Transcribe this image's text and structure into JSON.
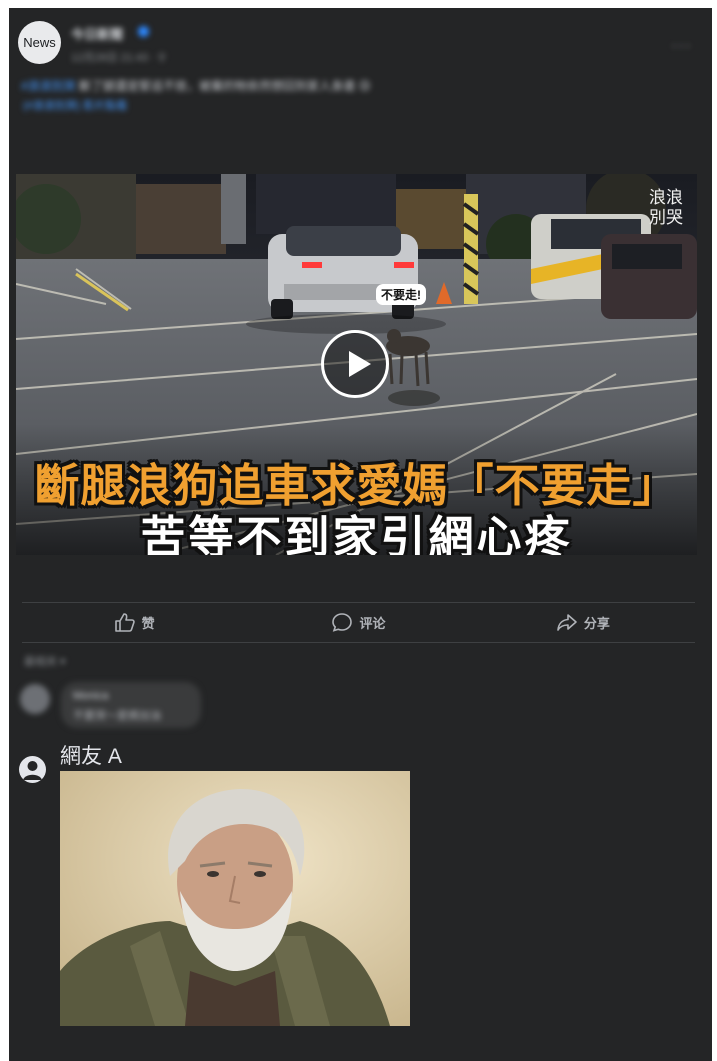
{
  "post": {
    "avatar_label": "News",
    "page_name": "今日新聞",
    "time": "12月28日 21:43 · ⚲",
    "more": "···",
    "caption_tag": "#浪浪別哭",
    "caption": " 斷了腿還是緊追不捨，被棄的牠依然想回到家人身邊 😢",
    "caption_link": "(#浪浪別哭) 影片點看"
  },
  "video": {
    "watermark_line1": "浪浪",
    "watermark_line2": "別哭",
    "bubble": "不要走!",
    "headline_line1": "斷腿浪狗追車求愛媽「不要走」",
    "headline_line2": "苦等不到家引網心疼"
  },
  "actions": {
    "like": "赞",
    "comment": "评论",
    "share": "分享"
  },
  "comments": {
    "sort_label": "最相关 ▾",
    "first": {
      "name": "Monica",
      "text": "不要哭～愛媽加油"
    },
    "second": {
      "name": "網友 A"
    }
  },
  "colors": {
    "card_bg": "#242526",
    "headline_orange": "#f0a030",
    "link_blue": "#4599ff"
  }
}
